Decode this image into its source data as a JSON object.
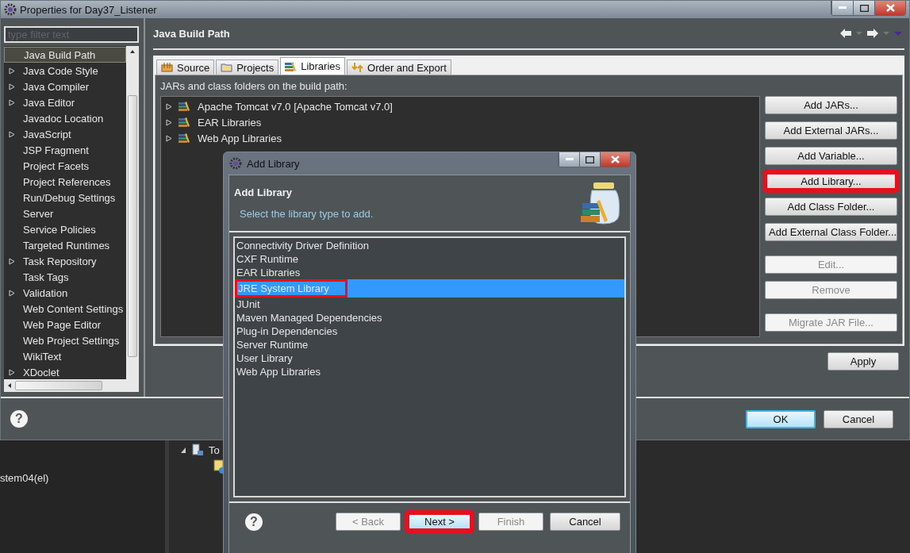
{
  "window": {
    "title": "Properties for Day37_Listener"
  },
  "filter": {
    "placeholder": "type filter text"
  },
  "nav_items": [
    {
      "label": "Java Build Path",
      "expandable": false,
      "selected": true
    },
    {
      "label": "Java Code Style",
      "expandable": true,
      "selected": false
    },
    {
      "label": "Java Compiler",
      "expandable": true,
      "selected": false
    },
    {
      "label": "Java Editor",
      "expandable": true,
      "selected": false
    },
    {
      "label": "Javadoc Location",
      "expandable": false,
      "selected": false
    },
    {
      "label": "JavaScript",
      "expandable": true,
      "selected": false
    },
    {
      "label": "JSP Fragment",
      "expandable": false,
      "selected": false
    },
    {
      "label": "Project Facets",
      "expandable": false,
      "selected": false
    },
    {
      "label": "Project References",
      "expandable": false,
      "selected": false
    },
    {
      "label": "Run/Debug Settings",
      "expandable": false,
      "selected": false
    },
    {
      "label": "Server",
      "expandable": false,
      "selected": false
    },
    {
      "label": "Service Policies",
      "expandable": false,
      "selected": false
    },
    {
      "label": "Targeted Runtimes",
      "expandable": false,
      "selected": false
    },
    {
      "label": "Task Repository",
      "expandable": true,
      "selected": false
    },
    {
      "label": "Task Tags",
      "expandable": false,
      "selected": false
    },
    {
      "label": "Validation",
      "expandable": true,
      "selected": false
    },
    {
      "label": "Web Content Settings",
      "expandable": false,
      "selected": false
    },
    {
      "label": "Web Page Editor",
      "expandable": false,
      "selected": false
    },
    {
      "label": "Web Project Settings",
      "expandable": false,
      "selected": false
    },
    {
      "label": "WikiText",
      "expandable": false,
      "selected": false
    },
    {
      "label": "XDoclet",
      "expandable": true,
      "selected": false
    }
  ],
  "page_title": "Java Build Path",
  "tabs": [
    {
      "label": "Source",
      "selected": false
    },
    {
      "label": "Projects",
      "selected": false
    },
    {
      "label": "Libraries",
      "selected": true
    },
    {
      "label": "Order and Export",
      "selected": false
    }
  ],
  "build_path": {
    "caption": "JARs and class folders on the build path:",
    "entries": [
      {
        "label": "Apache Tomcat v7.0 [Apache Tomcat v7.0]",
        "expanded": false
      },
      {
        "label": "EAR Libraries",
        "expanded": false
      },
      {
        "label": "Web App Libraries",
        "expanded": false
      }
    ],
    "button_groups": [
      [
        {
          "label": "Add JARs...",
          "disabled": false,
          "highlighted": false
        },
        {
          "label": "Add External JARs...",
          "disabled": false,
          "highlighted": false
        },
        {
          "label": "Add Variable...",
          "disabled": false,
          "highlighted": false
        },
        {
          "label": "Add Library...",
          "disabled": false,
          "highlighted": true
        },
        {
          "label": "Add Class Folder...",
          "disabled": false,
          "highlighted": false
        },
        {
          "label": "Add External Class Folder...",
          "disabled": false,
          "highlighted": false
        }
      ],
      [
        {
          "label": "Edit...",
          "disabled": true,
          "highlighted": false
        },
        {
          "label": "Remove",
          "disabled": true,
          "highlighted": false
        }
      ],
      [
        {
          "label": "Migrate JAR File...",
          "disabled": true,
          "highlighted": false
        }
      ]
    ]
  },
  "apply": "Apply",
  "help": "?",
  "footer_buttons": [
    {
      "label": "OK",
      "default": true
    },
    {
      "label": "Cancel",
      "default": false
    }
  ],
  "background_ide": {
    "left_text": "stem04(el)",
    "tree": [
      {
        "label": "To",
        "expanded": true
      }
    ]
  },
  "dialog": {
    "title": "Add Library",
    "heading": "Add Library",
    "subtitle": "Select the library type to add.",
    "types": [
      {
        "label": "Connectivity Driver Definition",
        "selected": false,
        "highlighted": false
      },
      {
        "label": "CXF Runtime",
        "selected": false,
        "highlighted": false
      },
      {
        "label": "EAR Libraries",
        "selected": false,
        "highlighted": false
      },
      {
        "label": "JRE System Library",
        "selected": true,
        "highlighted": true
      },
      {
        "label": "JUnit",
        "selected": false,
        "highlighted": false
      },
      {
        "label": "Maven Managed Dependencies",
        "selected": false,
        "highlighted": false
      },
      {
        "label": "Plug-in Dependencies",
        "selected": false,
        "highlighted": false
      },
      {
        "label": "Server Runtime",
        "selected": false,
        "highlighted": false
      },
      {
        "label": "User Library",
        "selected": false,
        "highlighted": false
      },
      {
        "label": "Web App Libraries",
        "selected": false,
        "highlighted": false
      }
    ],
    "help": "?",
    "buttons": [
      {
        "label": "< Back",
        "disabled": true,
        "default": false,
        "highlighted": false
      },
      {
        "label": "Next >",
        "disabled": false,
        "default": true,
        "highlighted": true
      },
      {
        "label": "Finish",
        "disabled": true,
        "default": false,
        "highlighted": false
      },
      {
        "label": "Cancel",
        "disabled": false,
        "default": false,
        "highlighted": false
      }
    ]
  }
}
